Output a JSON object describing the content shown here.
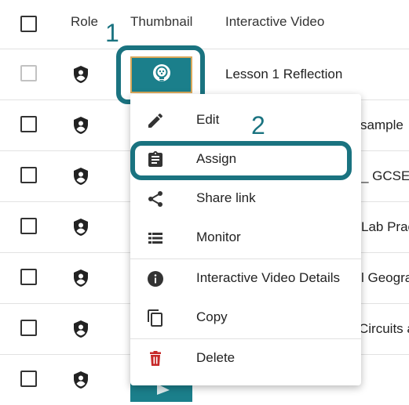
{
  "header": {
    "role": "Role",
    "thumbnail": "Thumbnail",
    "interactive_video": "Interactive Video"
  },
  "rows": [
    {
      "title": "Lesson 1 Reflection"
    },
    {
      "title": "sample"
    },
    {
      "title": "_ GCSE"
    },
    {
      "title": "Lab Prac"
    },
    {
      "title": "l Geogra"
    },
    {
      "title": "Circuits a"
    },
    {
      "title": ""
    }
  ],
  "menu": {
    "items": [
      {
        "label": "Edit",
        "icon": "pencil-icon"
      },
      {
        "label": "Assign",
        "icon": "clipboard-icon"
      },
      {
        "label": "Share link",
        "icon": "share-icon"
      },
      {
        "label": "Monitor",
        "icon": "list-icon"
      },
      {
        "label": "Interactive Video Details",
        "icon": "info-icon"
      },
      {
        "label": "Copy",
        "icon": "copy-icon"
      },
      {
        "label": "Delete",
        "icon": "trash-icon"
      }
    ]
  },
  "callouts": {
    "first": "1",
    "second": "2"
  },
  "colors": {
    "accent": "#1a7380",
    "thumbnail": "#1b7f8b",
    "delete": "#c62828"
  }
}
